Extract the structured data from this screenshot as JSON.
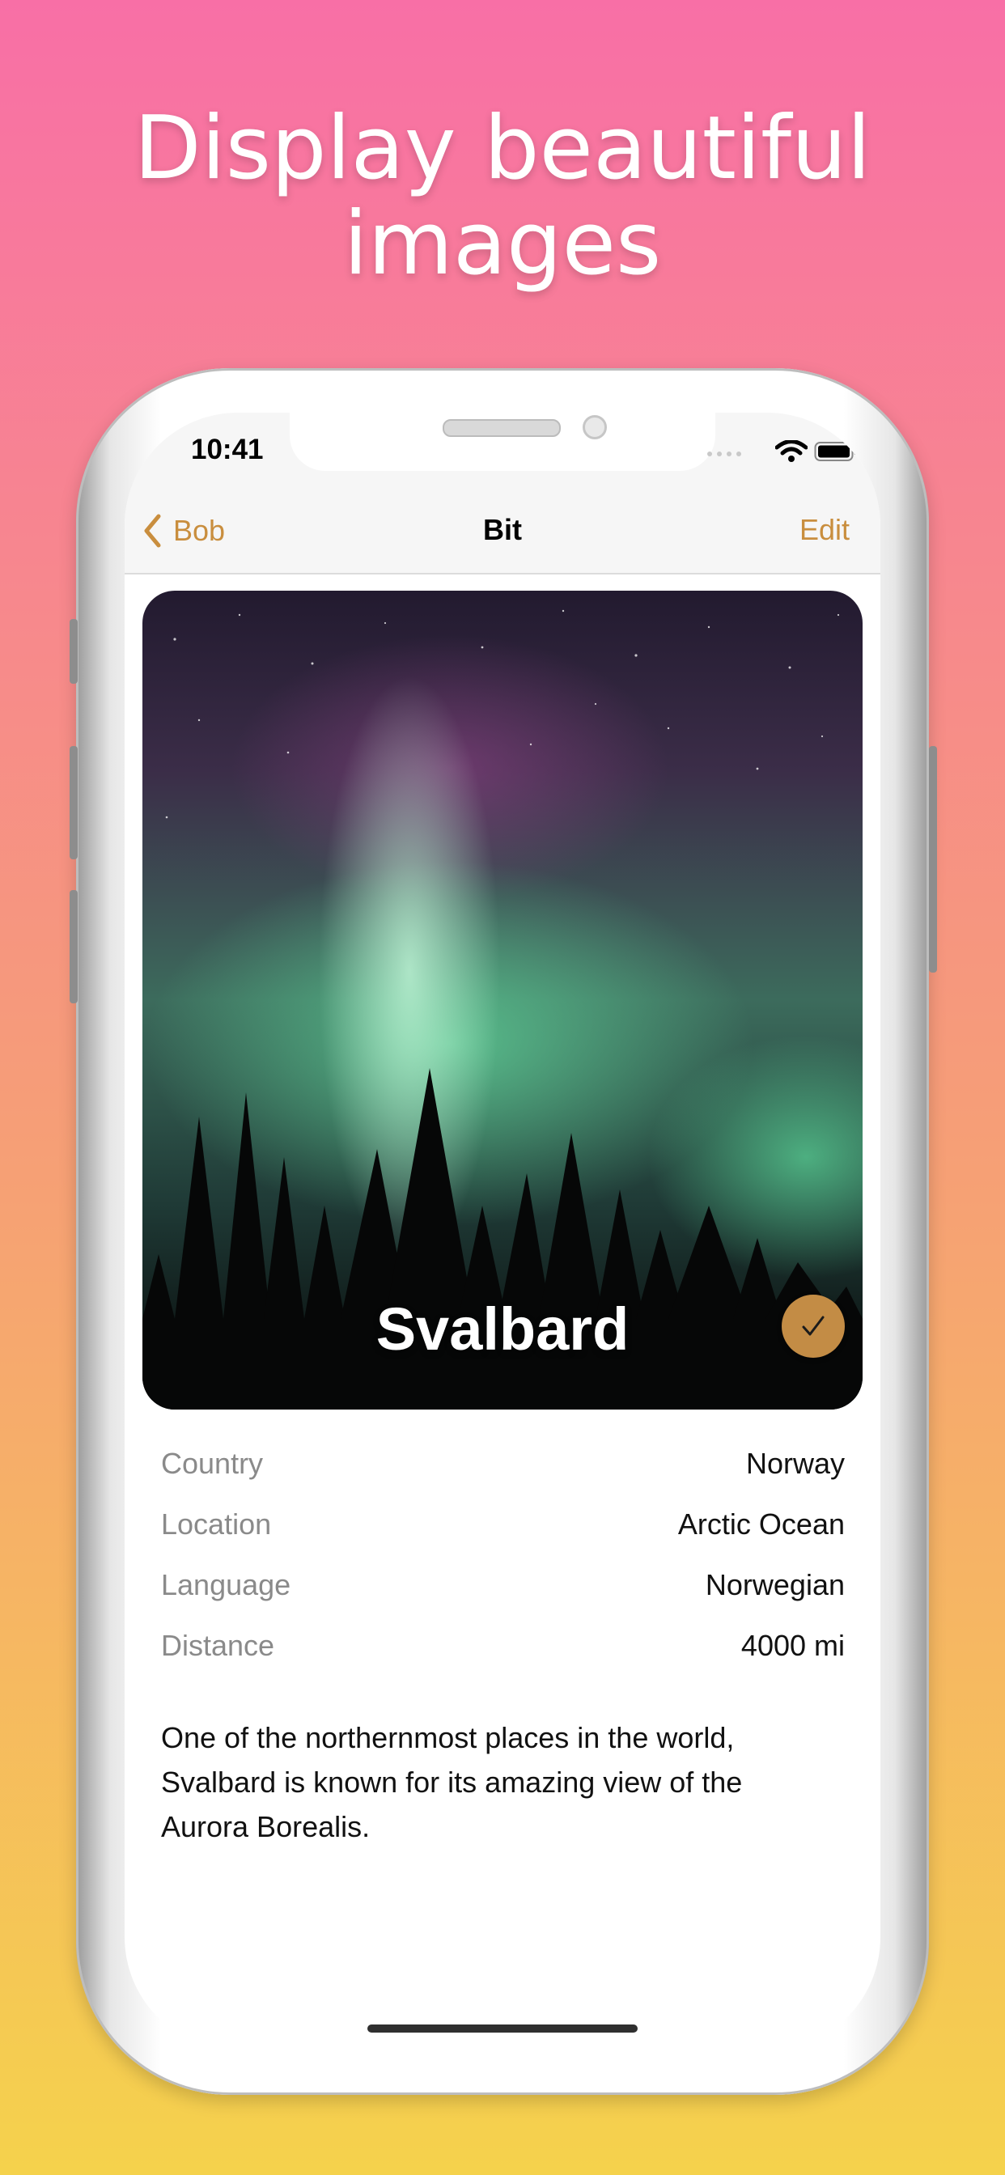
{
  "headline": {
    "line1": "Display beautiful",
    "line2": "images"
  },
  "status_bar": {
    "time": "10:41",
    "icons": [
      "wifi-icon",
      "battery-icon"
    ]
  },
  "nav": {
    "back_label": "Bob",
    "title": "Bit",
    "edit_label": "Edit"
  },
  "card": {
    "title": "Svalbard",
    "check_icon": "checkmark-icon",
    "image": "aurora-forest-photo"
  },
  "details": [
    {
      "label": "Country",
      "value": "Norway"
    },
    {
      "label": "Location",
      "value": "Arctic Ocean"
    },
    {
      "label": "Language",
      "value": "Norwegian"
    },
    {
      "label": "Distance",
      "value": "4000 mi"
    }
  ],
  "description": {
    "line1": "One of the northernmost places in the world,",
    "line2": "Svalbard is known for its amazing view of the",
    "line3": "Aurora Borealis."
  },
  "colors": {
    "accent": "#c98e3e",
    "check_button": "#c38c45"
  }
}
